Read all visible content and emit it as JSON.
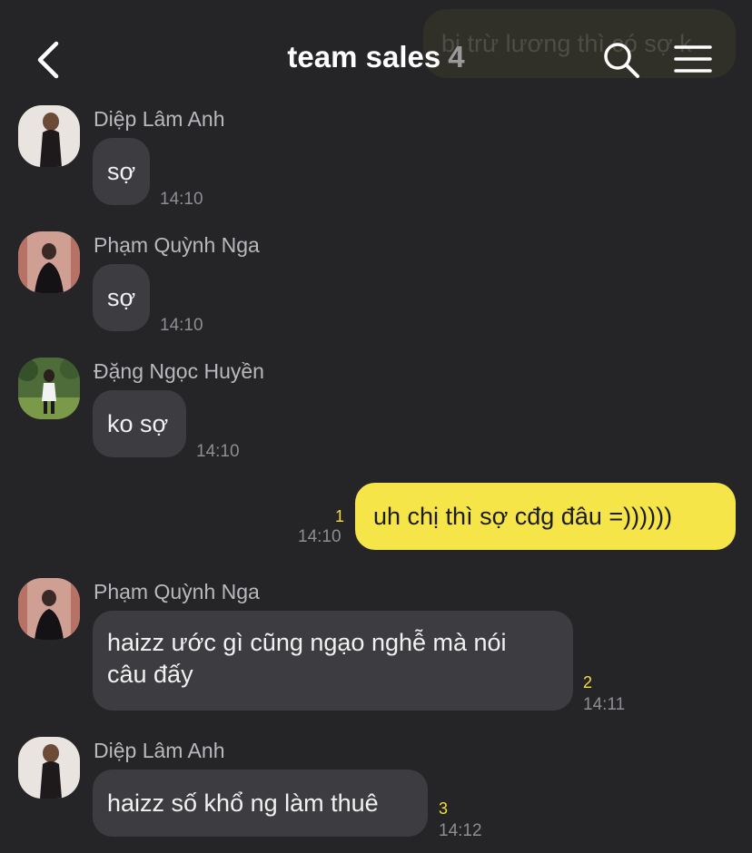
{
  "header": {
    "ghost_text": "bị trừ lương thì có sợ k",
    "title": "team sales",
    "member_count": "4"
  },
  "messages": [
    {
      "sender": "Diệp Lâm Anh",
      "text": "sợ",
      "time": "14:10"
    },
    {
      "sender": "Phạm Quỳnh Nga",
      "text": "sợ",
      "time": "14:10"
    },
    {
      "sender": "Đặng Ngọc Huyền",
      "text": "ko sợ",
      "time": "14:10"
    },
    {
      "text": "uh chị thì sợ cđg đâu =))))))",
      "time": "14:10",
      "unread": "1"
    },
    {
      "sender": "Phạm Quỳnh Nga",
      "text_line1": "haizz ước gì cũng ngạo nghễ mà nói",
      "text_line2": "câu đấy",
      "time": "14:11",
      "unread": "2"
    },
    {
      "sender": "Diệp Lâm Anh",
      "text": "haizz số khổ ng làm thuê",
      "time": "14:12",
      "unread": "3"
    }
  ],
  "colors": {
    "background": "#252528",
    "bubble_other": "#3d3d41",
    "bubble_mine": "#f6e549",
    "unread_count": "#f3dd41"
  }
}
